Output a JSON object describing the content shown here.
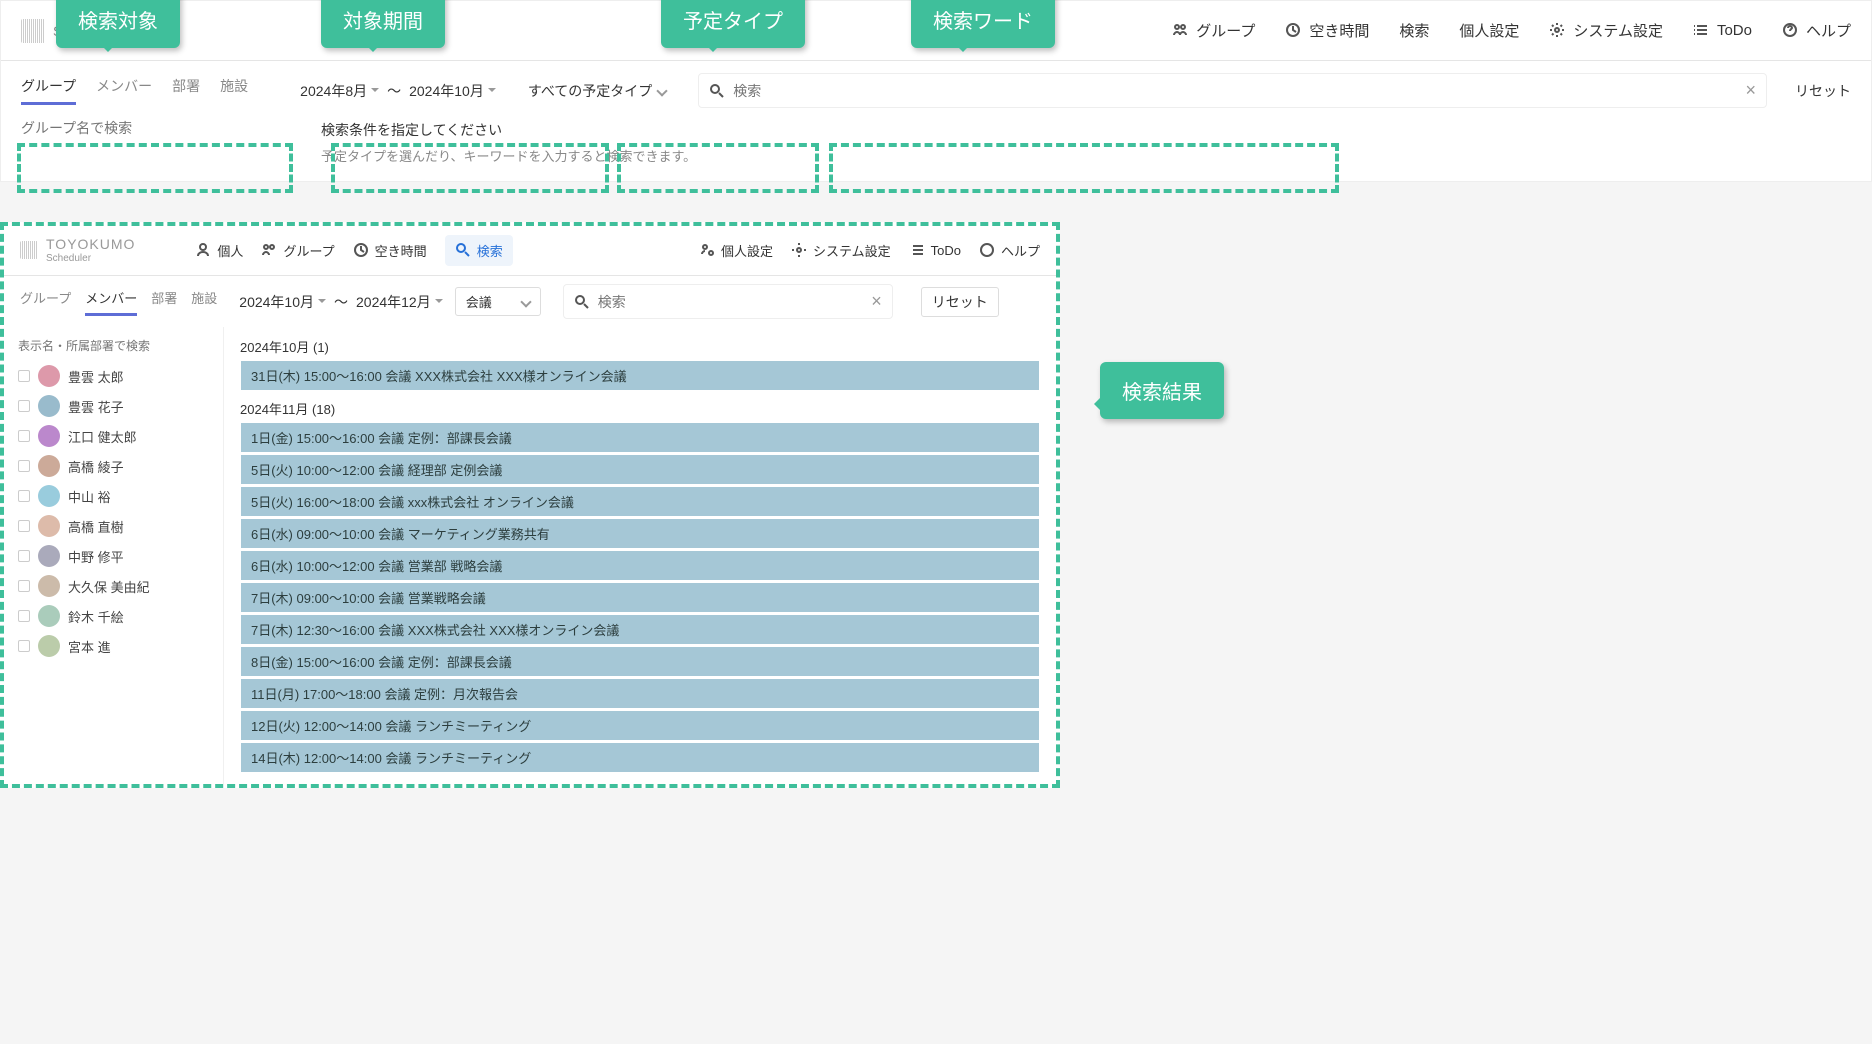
{
  "panel1": {
    "logo": "Scheduler",
    "nav": {
      "group": "グループ",
      "freetime": "空き時間",
      "search": "検索",
      "personal_settings": "個人設定",
      "system_settings": "システム設定",
      "todo": "ToDo",
      "help": "ヘルプ"
    },
    "tabs": {
      "group": "グループ",
      "member": "メンバー",
      "department": "部署",
      "facility": "施設"
    },
    "period": {
      "from": "2024年8月",
      "sep": "〜",
      "to": "2024年10月"
    },
    "type_all": "すべての予定タイプ",
    "search_placeholder": "検索",
    "reset": "リセット",
    "groupname_placeholder": "グループ名で検索",
    "hint1": "検索条件を指定してください",
    "hint2": "予定タイプを選んだり、キーワードを入力すると検索できます。"
  },
  "callouts": {
    "target": "検索対象",
    "period": "対象期間",
    "type": "予定タイプ",
    "keyword": "検索ワード",
    "results": "検索結果"
  },
  "panel2": {
    "logo1": "TOYOKUMO",
    "logo2": "Scheduler",
    "nav": {
      "individual": "個人",
      "group": "グループ",
      "freetime": "空き時間",
      "search": "検索",
      "personal_settings": "個人設定",
      "system_settings": "システム設定",
      "todo": "ToDo",
      "help": "ヘルプ"
    },
    "tabs": {
      "group": "グループ",
      "member": "メンバー",
      "department": "部署",
      "facility": "施設"
    },
    "period": {
      "from": "2024年10月",
      "sep": "〜",
      "to": "2024年12月"
    },
    "type_selected": "会議",
    "search_placeholder": "検索",
    "reset": "リセット",
    "sidebar_search_placeholder": "表示名・所属部署で検索",
    "members": [
      "豊雲 太郎",
      "豊雲 花子",
      "江口 健太郎",
      "高橋 綾子",
      "中山 裕",
      "高橋 直樹",
      "中野 修平",
      "大久保 美由紀",
      "鈴木 千絵",
      "宮本 進"
    ],
    "month_oct": "2024年10月 (1)",
    "events_oct": [
      "31日(木) 15:00〜16:00 会議 XXX株式会社 XXX様オンライン会議"
    ],
    "month_nov": "2024年11月 (18)",
    "events_nov": [
      "1日(金) 15:00〜16:00 会議 定例：部課長会議",
      "5日(火) 10:00〜12:00 会議 経理部 定例会議",
      "5日(火) 16:00〜18:00 会議 xxx株式会社 オンライン会議",
      "6日(水) 09:00〜10:00 会議 マーケティング業務共有",
      "6日(水) 10:00〜12:00 会議 営業部 戦略会議",
      "7日(木) 09:00〜10:00 会議 営業戦略会議",
      "7日(木) 12:30〜16:00 会議 XXX株式会社 XXX様オンライン会議",
      "8日(金) 15:00〜16:00 会議 定例：部課長会議",
      "11日(月) 17:00〜18:00 会議 定例：月次報告会",
      "12日(火) 12:00〜14:00 会議 ランチミーティング",
      "14日(木) 12:00〜14:00 会議 ランチミーティング"
    ]
  }
}
